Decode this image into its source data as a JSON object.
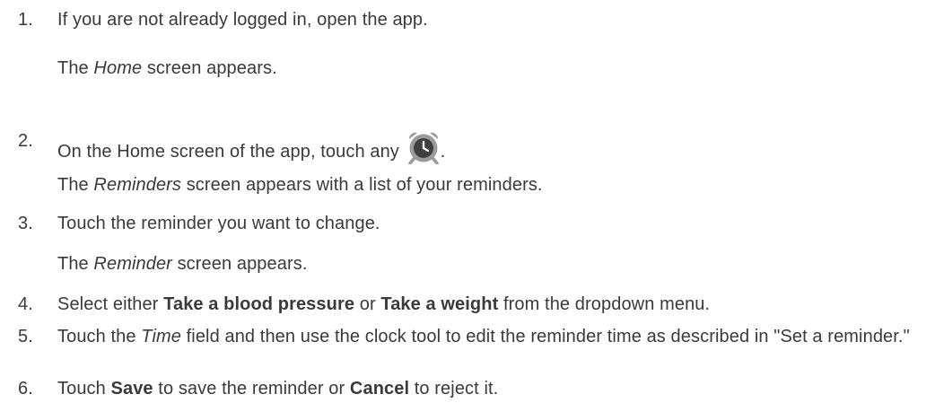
{
  "steps": [
    {
      "number": "1.",
      "text": "If you are not already logged in, open the app.",
      "result": {
        "before": "The ",
        "em": "Home",
        "after": " screen appears."
      }
    },
    {
      "number": "2.",
      "text_before": "On the Home screen of the app, touch any ",
      "icon": "alarm-clock-icon",
      "text_after": ".",
      "result": {
        "before": "The ",
        "em": "Reminders",
        "after": " screen appears with a list of your reminders."
      }
    },
    {
      "number": "3.",
      "text": "Touch the reminder you want to change.",
      "result": {
        "before": "The ",
        "em": "Reminder",
        "after": " screen appears."
      }
    },
    {
      "number": "4.",
      "parts": [
        "Select either ",
        "Take a blood pressure",
        " or ",
        "Take a weight",
        " from the dropdown menu."
      ]
    },
    {
      "number": "5.",
      "parts": [
        "Touch the ",
        "Time",
        " field and then use the clock tool to edit the reminder time as described in \"Set a reminder.\""
      ]
    },
    {
      "number": "6.",
      "parts": [
        "Touch ",
        "Save",
        " to save the reminder or ",
        "Cancel",
        " to reject it."
      ]
    }
  ],
  "colors": {
    "text": "#3a3a3a",
    "icon_body": "#9a9a9a",
    "icon_face": "#3f3f3f"
  }
}
